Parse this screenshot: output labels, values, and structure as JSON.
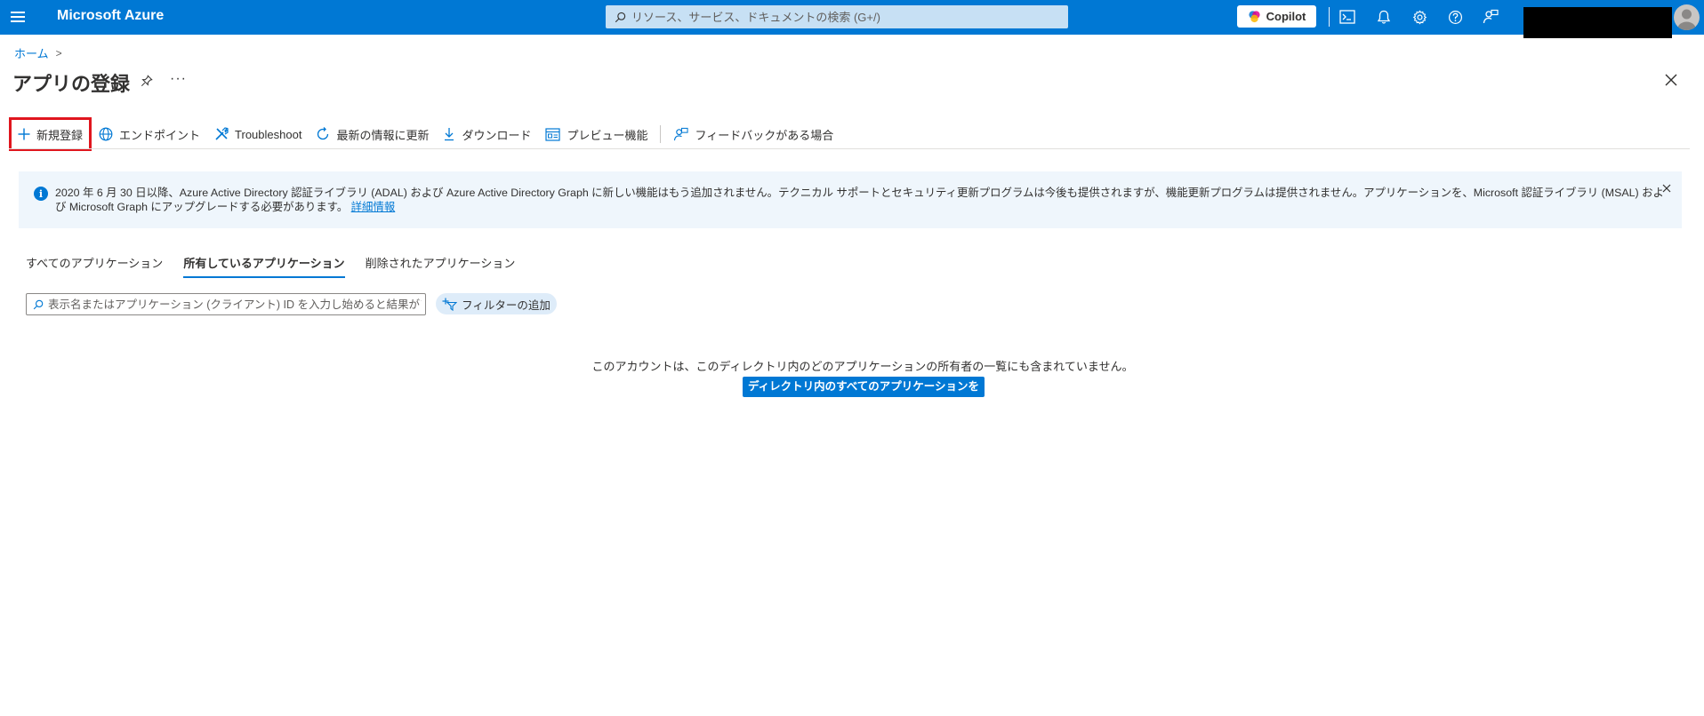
{
  "topbar": {
    "brand": "Microsoft Azure",
    "search_placeholder": "リソース、サービス、ドキュメントの検索 (G+/)",
    "copilot_label": "Copilot",
    "accent_color": "#0078d4"
  },
  "breadcrumb": {
    "home": "ホーム",
    "separator": ">"
  },
  "page": {
    "title": "アプリの登録",
    "more": "···"
  },
  "commands": {
    "new_registration": "新規登録",
    "endpoints": "エンドポイント",
    "troubleshoot": "Troubleshoot",
    "refresh": "最新の情報に更新",
    "download": "ダウンロード",
    "preview": "プレビュー機能",
    "feedback": "フィードバックがある場合"
  },
  "banner": {
    "text": "2020 年 6 月 30 日以降、Azure Active Directory 認証ライブラリ (ADAL) および Azure Active Directory Graph に新しい機能はもう追加されません。テクニカル サポートとセキュリティ更新プログラムは今後も提供されますが、機能更新プログラムは提供されません。アプリケーションを、Microsoft 認証ライブラリ (MSAL) および Microsoft Graph にアップグレードする必要があります。",
    "link": "詳細情報"
  },
  "tabs": [
    {
      "label": "すべてのアプリケーション",
      "active": false
    },
    {
      "label": "所有しているアプリケーション",
      "active": true
    },
    {
      "label": "削除されたアプリケーション",
      "active": false
    }
  ],
  "filter": {
    "search_placeholder": "表示名またはアプリケーション (クライアント) ID を入力し始めると結果がフィ···",
    "add_filter_label": "フィルターの追加"
  },
  "empty_state": {
    "message": "このアカウントは、このディレクトリ内のどのアプリケーションの所有者の一覧にも含まれていません。",
    "button_label": "ディレクトリ内のすべてのアプリケーションを表示"
  }
}
